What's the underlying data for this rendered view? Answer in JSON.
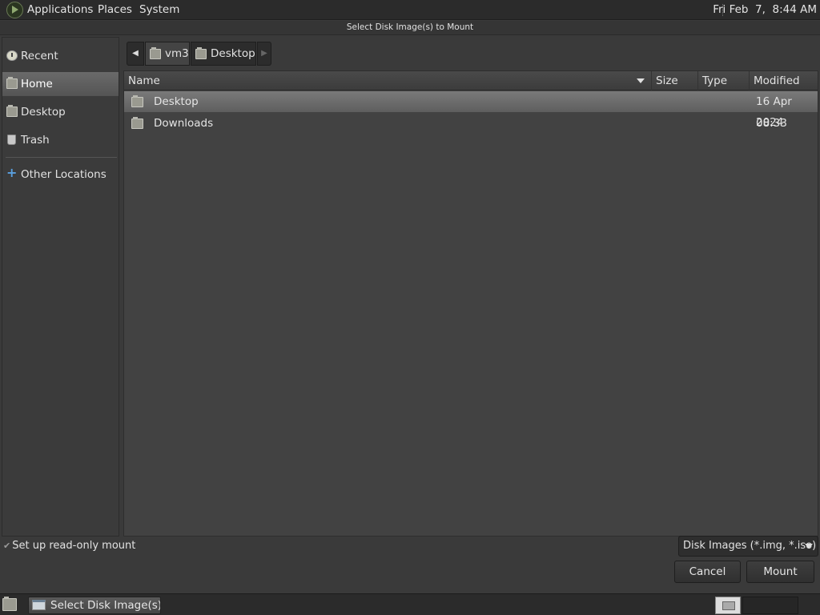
{
  "top_panel": {
    "menus": [
      "Applications",
      "Places",
      "System"
    ],
    "clock": "Fri Feb  7,  8:44 AM"
  },
  "window": {
    "title": "Select Disk Image(s) to Mount"
  },
  "sidebar": {
    "items": [
      {
        "label": "Recent",
        "icon": "clock-icon"
      },
      {
        "label": "Home",
        "icon": "home-folder-icon",
        "active": true
      },
      {
        "label": "Desktop",
        "icon": "desktop-folder-icon"
      },
      {
        "label": "Trash",
        "icon": "trash-icon"
      },
      {
        "label": "Other Locations",
        "icon": "plus-icon"
      }
    ]
  },
  "pathbar": {
    "segments": [
      "vm3",
      "Desktop"
    ]
  },
  "file_list": {
    "columns": [
      "Name",
      "Size",
      "Type",
      "Modified"
    ],
    "rows": [
      {
        "name": "Desktop",
        "size": "",
        "type": "",
        "modified": "16 Apr 2024",
        "selected": true
      },
      {
        "name": "Downloads",
        "size": "",
        "type": "",
        "modified": "08:33",
        "selected": false
      }
    ]
  },
  "options": {
    "readonly_label": "Set up read-only mount",
    "readonly_checked": true,
    "filter_label": "Disk Images (*.img, *.iso)"
  },
  "buttons": {
    "cancel": "Cancel",
    "mount": "Mount"
  },
  "taskbar": {
    "task_label": "Select Disk Image(s)..."
  }
}
